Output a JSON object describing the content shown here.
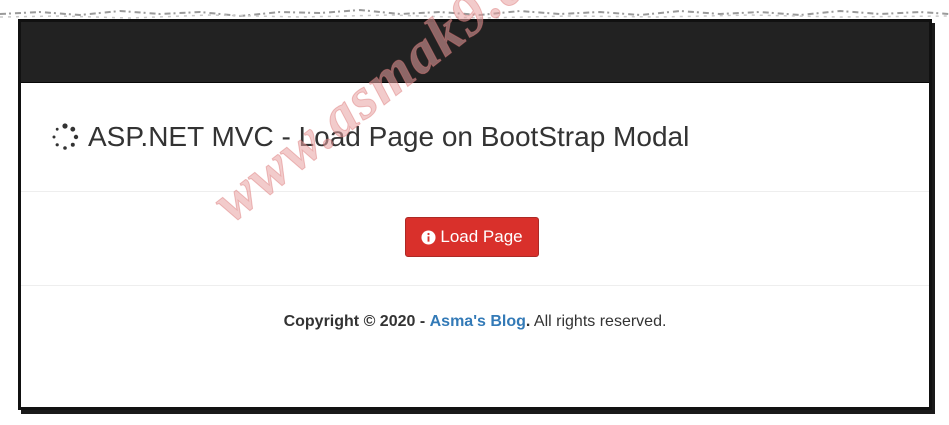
{
  "header": {
    "title": "ASP.NET MVC - Load Page on BootStrap Modal"
  },
  "icons": {
    "title_icon": "spinner-icon",
    "button_icon": "info-circle-icon"
  },
  "actions": {
    "load_page_label": "Load Page"
  },
  "footer": {
    "copyright_prefix": "Copyright © 2020 -",
    "link_text": "Asma's Blog",
    "period": ".",
    "suffix": "All rights reserved."
  },
  "watermark": {
    "text": "www.asmak9.com"
  },
  "colors": {
    "navbar": "#222222",
    "button": "#d9302b",
    "link": "#337ab7",
    "watermark": "#e8a0a0"
  }
}
